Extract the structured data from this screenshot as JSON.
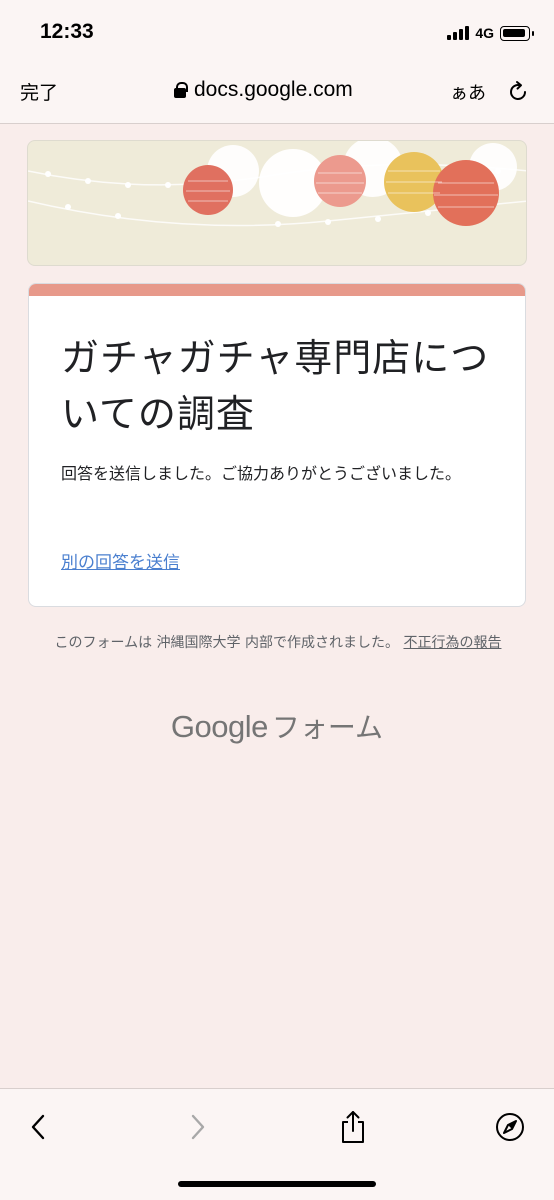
{
  "status_bar": {
    "time": "12:33",
    "network": "4G"
  },
  "browser": {
    "done_label": "完了",
    "url": "docs.google.com",
    "text_size_label": "ぁあ"
  },
  "form": {
    "title": "ガチャガチャ専門店についての調査",
    "confirmation": "回答を送信しました。ご協力ありがとうございました。",
    "resubmit_link": "別の回答を送信"
  },
  "footer": {
    "note": "このフォームは 沖縄国際大学 内部で作成されました。",
    "report_link": "不正行為の報告"
  },
  "brand": {
    "google": "Google",
    "forms": "フォーム"
  },
  "colors": {
    "accent": "#e7998a",
    "link": "#4a7fcf",
    "background": "#f9edeb"
  },
  "toolbar": {
    "icons": [
      "back-icon",
      "forward-icon",
      "share-icon",
      "compass-icon"
    ]
  }
}
